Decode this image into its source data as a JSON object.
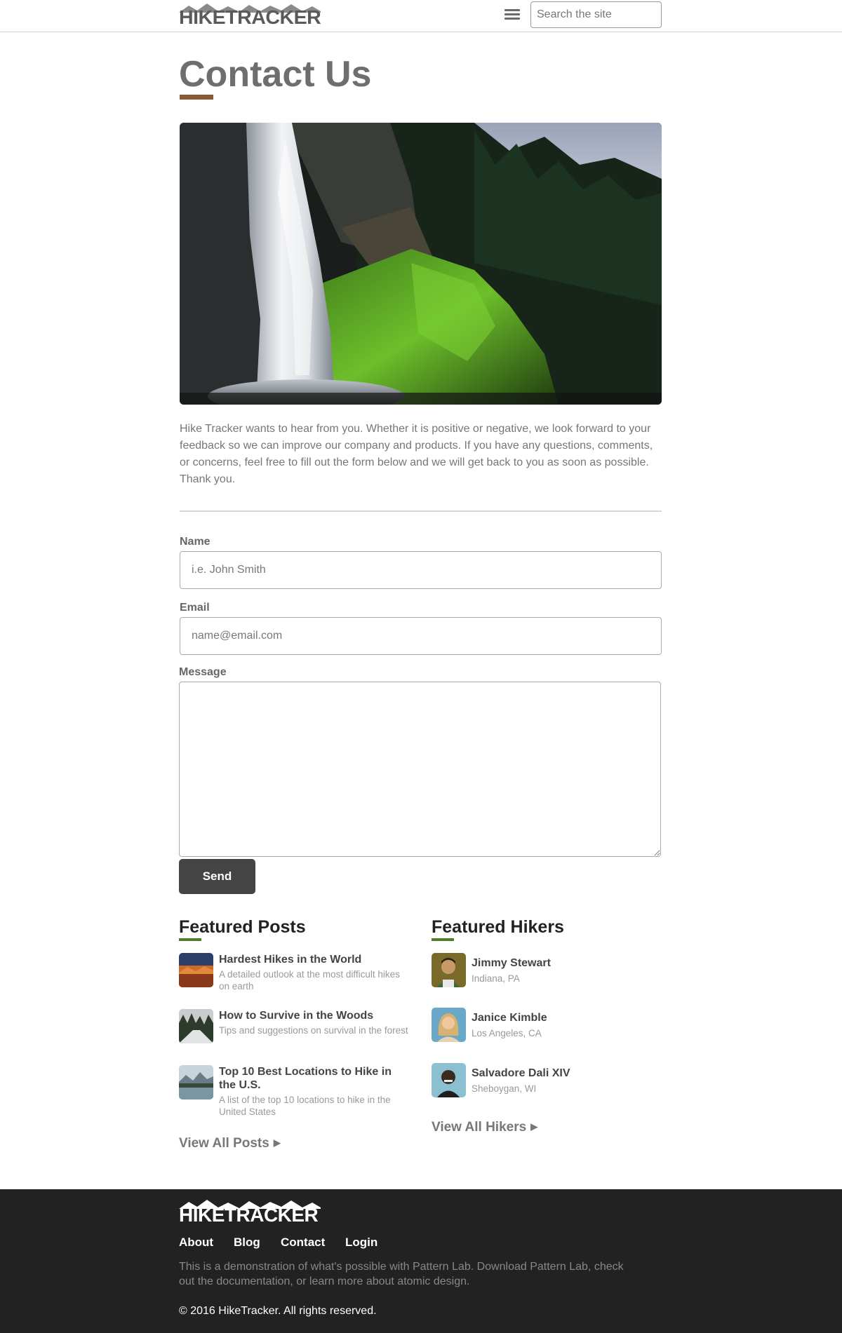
{
  "header": {
    "logo_text": "HIKETRACKER",
    "search_placeholder": "Search the site"
  },
  "page": {
    "title": "Contact Us",
    "intro": "Hike Tracker wants to hear from you. Whether it is positive or negative, we look forward to your feedback so we can improve our company and products. If you have any questions, comments, or concerns, feel free to fill out the form below and we will get back to you as soon as possible. Thank you."
  },
  "form": {
    "name_label": "Name",
    "name_placeholder": "i.e. John Smith",
    "email_label": "Email",
    "email_placeholder": "name@email.com",
    "message_label": "Message",
    "send_label": "Send"
  },
  "featured_posts": {
    "title": "Featured Posts",
    "items": [
      {
        "title": "Hardest Hikes in the World",
        "desc": "A detailed outlook at the most difficult hikes on earth"
      },
      {
        "title": "How to Survive in the Woods",
        "desc": "Tips and suggestions on survival in the forest"
      },
      {
        "title": "Top 10 Best Locations to Hike in the U.S.",
        "desc": "A list of the top 10 locations to hike in the United States"
      }
    ],
    "view_all": "View All Posts"
  },
  "featured_hikers": {
    "title": "Featured Hikers",
    "items": [
      {
        "name": "Jimmy Stewart",
        "location": "Indiana, PA"
      },
      {
        "name": "Janice Kimble",
        "location": "Los Angeles, CA"
      },
      {
        "name": "Salvadore Dali XIV",
        "location": "Sheboygan, WI"
      }
    ],
    "view_all": "View All Hikers"
  },
  "footer": {
    "logo_text": "HIKETRACKER",
    "nav": [
      "About",
      "Blog",
      "Contact",
      "Login"
    ],
    "text": "This is a demonstration of what's possible with Pattern Lab. Download Pattern Lab, check out the documentation, or learn more about atomic design.",
    "copyright": "© 2016 HikeTracker. All rights reserved."
  },
  "colors": {
    "accent_brown": "#8a5a34",
    "accent_green": "#4f7f2a",
    "button_dark": "#444444",
    "footer_bg": "#222222"
  }
}
